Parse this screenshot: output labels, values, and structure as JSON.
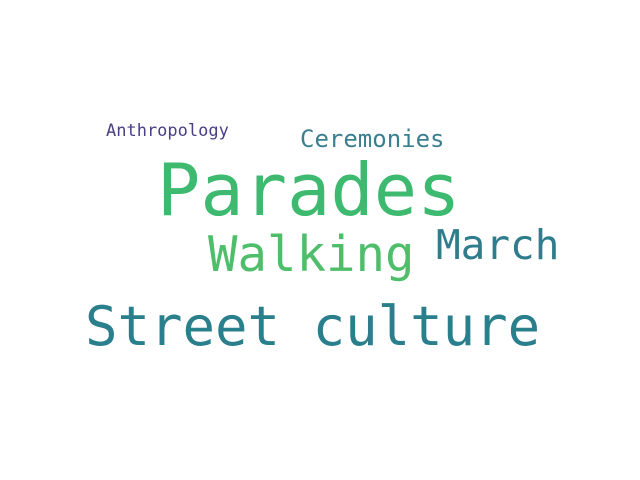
{
  "words": [
    {
      "text": "Anthropology",
      "color": "#4a3f85"
    },
    {
      "text": "Ceremonies",
      "color": "#3b7f8f"
    },
    {
      "text": "Parades",
      "color": "#3dba6f"
    },
    {
      "text": "Walking",
      "color": "#4fbe6a"
    },
    {
      "text": "March",
      "color": "#2f7d8c"
    },
    {
      "text": "Street culture",
      "color": "#2a7f8c"
    }
  ]
}
